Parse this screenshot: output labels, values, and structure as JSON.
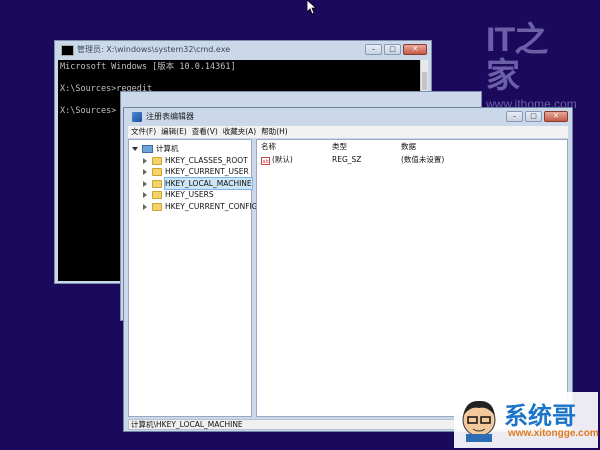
{
  "watermark_top": {
    "logo": "IT之家",
    "url": "www.ithome.com"
  },
  "cmd": {
    "title": "管理员: X:\\windows\\system32\\cmd.exe",
    "lines": [
      "Microsoft Windows [版本 10.0.14361]",
      "",
      "X:\\Sources>regedit",
      "",
      "X:\\Sources>"
    ]
  },
  "regedit": {
    "title": "注册表编辑器",
    "menu": [
      "文件(F)",
      "编辑(E)",
      "查看(V)",
      "收藏夹(A)",
      "帮助(H)"
    ],
    "tree": {
      "root": "计算机",
      "hives": [
        "HKEY_CLASSES_ROOT",
        "HKEY_CURRENT_USER",
        "HKEY_LOCAL_MACHINE",
        "HKEY_USERS",
        "HKEY_CURRENT_CONFIG"
      ],
      "selected": "HKEY_LOCAL_MACHINE"
    },
    "columns": {
      "name": "名称",
      "type": "类型",
      "data": "数据"
    },
    "rows": [
      {
        "name": "(默认)",
        "type": "REG_SZ",
        "data": "(数值未设置)"
      }
    ],
    "status": "计算机\\HKEY_LOCAL_MACHINE"
  },
  "watermark_bottom": {
    "name": "系统哥",
    "url": "www.xitongge.com"
  },
  "colors": {
    "desktop": "#1b0a5c",
    "selection": "#cde6f7",
    "folder": "#f4d46a"
  }
}
